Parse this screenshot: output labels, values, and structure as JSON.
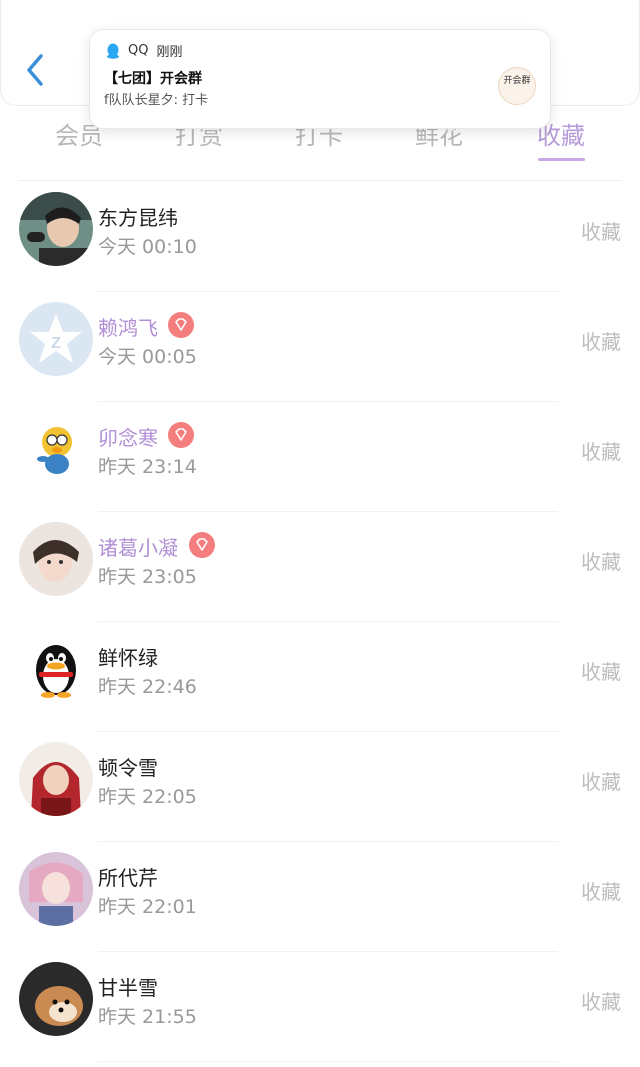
{
  "header": {
    "back_icon": "chevron-left-icon",
    "accent": "#3a8fd8"
  },
  "tabs": [
    {
      "label": "会员"
    },
    {
      "label": "打赏"
    },
    {
      "label": "打卡"
    },
    {
      "label": "鲜花"
    },
    {
      "label": "收藏"
    }
  ],
  "active_tab": "收藏",
  "notification": {
    "app_name": "QQ",
    "time": "刚刚",
    "title": "【七团】开会群",
    "message": "f队队长星夕: 打卡",
    "thumb_text": "开会群"
  },
  "rows": [
    {
      "name": "东方昆纬",
      "time": "今天 00:10",
      "action": "收藏",
      "vip": false
    },
    {
      "name": "赖鸿飞",
      "time": "今天 00:05",
      "action": "收藏",
      "vip": true
    },
    {
      "name": "卯念寒",
      "time": "昨天 23:14",
      "action": "收藏",
      "vip": true
    },
    {
      "name": "诸葛小凝",
      "time": "昨天 23:05",
      "action": "收藏",
      "vip": true
    },
    {
      "name": "鲜怀绿",
      "time": "昨天 22:46",
      "action": "收藏",
      "vip": false
    },
    {
      "name": "顿令雪",
      "time": "昨天 22:05",
      "action": "收藏",
      "vip": false
    },
    {
      "name": "所代芹",
      "time": "昨天 22:01",
      "action": "收藏",
      "vip": false
    },
    {
      "name": "甘半雪",
      "time": "昨天 21:55",
      "action": "收藏",
      "vip": false
    }
  ],
  "colors": {
    "active_tab": "#b59bd9",
    "vip_name": "#b08fd6",
    "vip_badge": "#f47d7d"
  }
}
